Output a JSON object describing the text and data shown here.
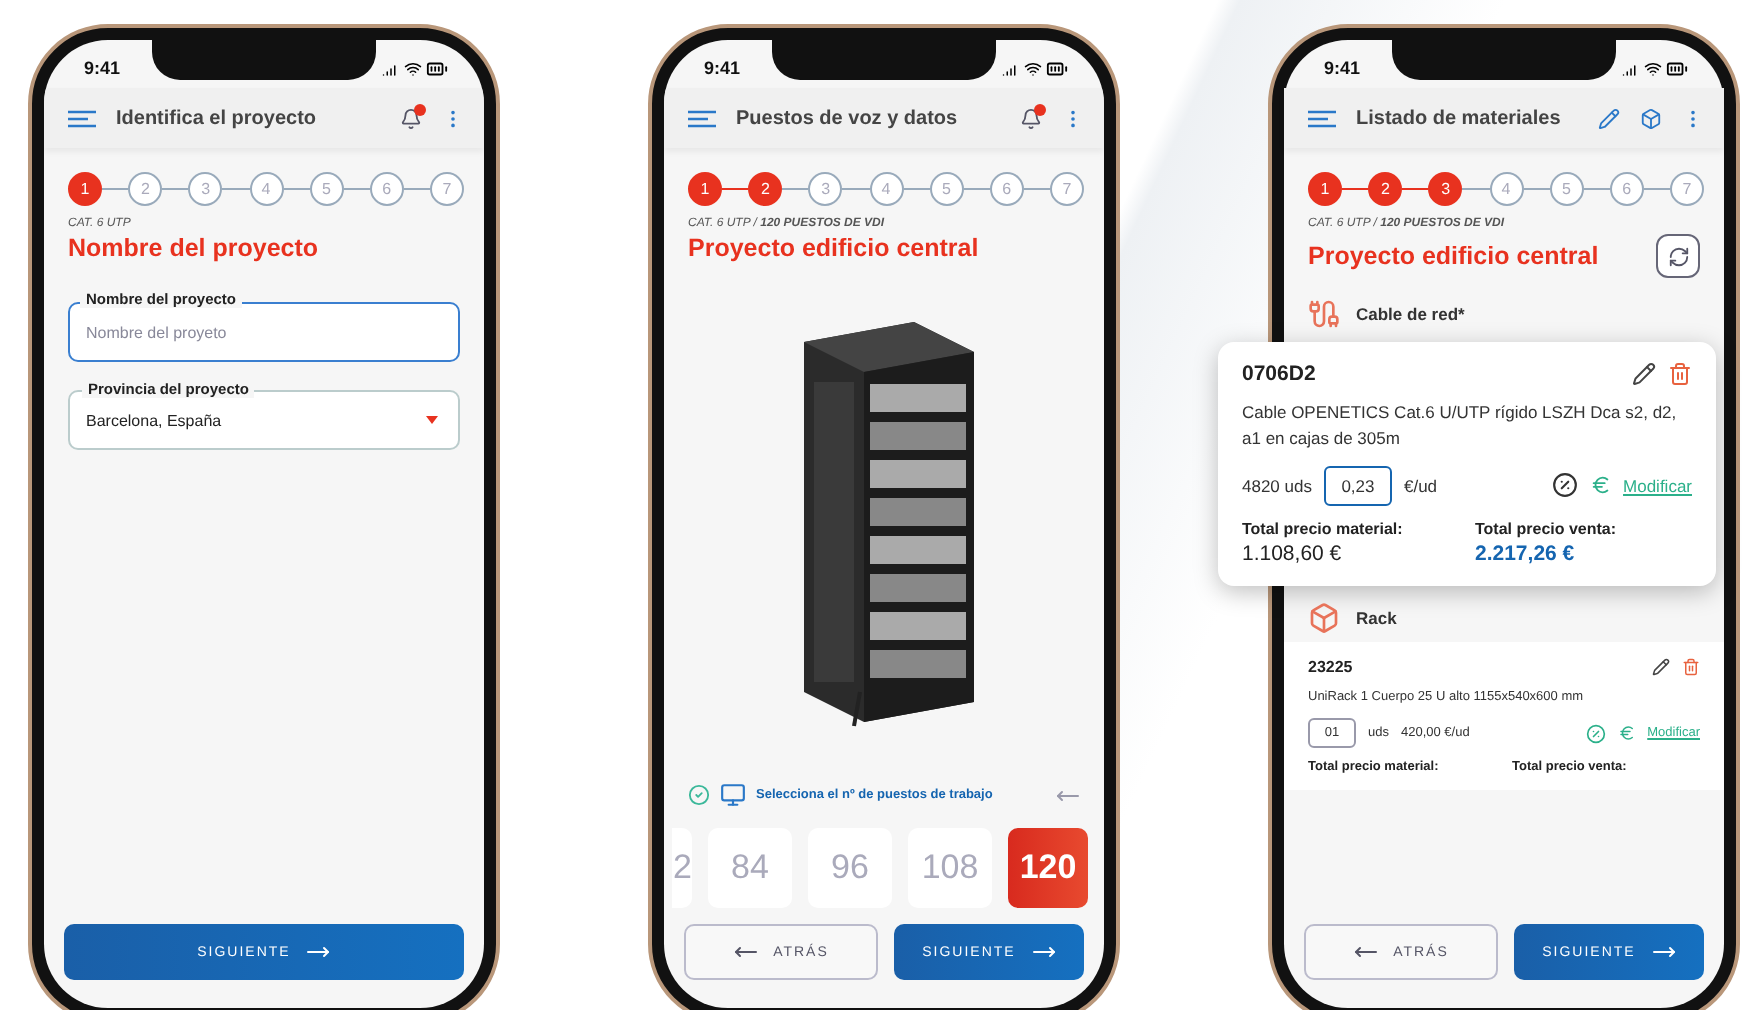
{
  "screens": [
    {
      "kind": "project_form",
      "time": "9:41",
      "title": "Identifica el proyecto",
      "notification": true,
      "steps": [
        {
          "label": "1",
          "done": true
        },
        {
          "label": "2",
          "done": false
        },
        {
          "label": "3",
          "done": false
        },
        {
          "label": "4",
          "done": false
        },
        {
          "label": "5",
          "done": false
        },
        {
          "label": "6",
          "done": false
        },
        {
          "label": "7",
          "done": false
        }
      ],
      "breadcrumb": "CAT. 6 UTP",
      "heading": "Nombre del proyecto",
      "fields": [
        {
          "kind": "text",
          "label": "Nombre del proyecto",
          "placeholder": "Nombre del proyeto",
          "focused": true
        },
        {
          "kind": "select",
          "label": "Provincia del proyecto",
          "value": "Barcelona, España",
          "focused": false
        }
      ],
      "buttons": [
        {
          "kind": "primary",
          "label": "SIGUIENTE"
        }
      ]
    },
    {
      "kind": "workstations",
      "time": "9:41",
      "title": "Puestos de voz y datos",
      "notification": true,
      "steps": [
        {
          "label": "1",
          "done": true
        },
        {
          "label": "2",
          "done": true
        },
        {
          "label": "3",
          "done": false
        },
        {
          "label": "4",
          "done": false
        },
        {
          "label": "5",
          "done": false
        },
        {
          "label": "6",
          "done": false
        },
        {
          "label": "7",
          "done": false
        }
      ],
      "breadcrumb": "CAT. 6 UTP / **120 PUESTOS DE VDI**",
      "heading": "Proyecto edificio central",
      "prompt": "Selecciona el nº de puestos de trabajo",
      "options": [
        {
          "label": "2",
          "selected": false
        },
        {
          "label": "84",
          "selected": false
        },
        {
          "label": "96",
          "selected": false
        },
        {
          "label": "108",
          "selected": false
        },
        {
          "label": "120",
          "selected": true
        }
      ],
      "buttons": [
        {
          "kind": "secondary",
          "label": "ATRÁS"
        },
        {
          "kind": "primary",
          "label": "SIGUIENTE"
        }
      ]
    },
    {
      "kind": "materials",
      "time": "9:41",
      "title": "Listado de materiales",
      "steps": [
        {
          "label": "1",
          "done": true
        },
        {
          "label": "2",
          "done": true
        },
        {
          "label": "3",
          "done": true
        },
        {
          "label": "4",
          "done": false
        },
        {
          "label": "5",
          "done": false
        },
        {
          "label": "6",
          "done": false
        },
        {
          "label": "7",
          "done": false
        }
      ],
      "breadcrumb": "CAT. 6 UTP / **120 PUESTOS DE VDI**",
      "heading": "Proyecto edificio central",
      "sections": [
        {
          "kind": "cable",
          "name": "Cable de red*",
          "items": [
            {
              "kind": "editing",
              "code": "0706D2",
              "description": "Cable OPENETICS Cat.6 U/UTP rígido LSZH Dca s2, d2, a1 en cajas de 305m",
              "quantity": "4820 uds",
              "price": "0,23",
              "price_unit": "€/ud",
              "link": "Modificar",
              "totals": [
                {
                  "label": "Total precio material:",
                  "value": "1.108,60 €"
                },
                {
                  "label": "Total precio venta:",
                  "value": "2.217,26 €"
                }
              ]
            }
          ]
        },
        {
          "kind": "rack",
          "name": "Rack",
          "items": [
            {
              "kind": "listed",
              "code": "23225",
              "description": "UniRack 1 Cuerpo 25 U alto 1155x540x600 mm",
              "quantity": "01",
              "quantity_unit": "uds",
              "price": "420,00 €/ud",
              "link": "Modificar",
              "totals": [
                {
                  "label": "Total precio material:"
                },
                {
                  "label": "Total precio venta:"
                }
              ]
            }
          ]
        }
      ],
      "buttons": [
        {
          "kind": "secondary",
          "label": "ATRÁS"
        },
        {
          "kind": "primary",
          "label": "SIGUIENTE"
        }
      ]
    }
  ]
}
